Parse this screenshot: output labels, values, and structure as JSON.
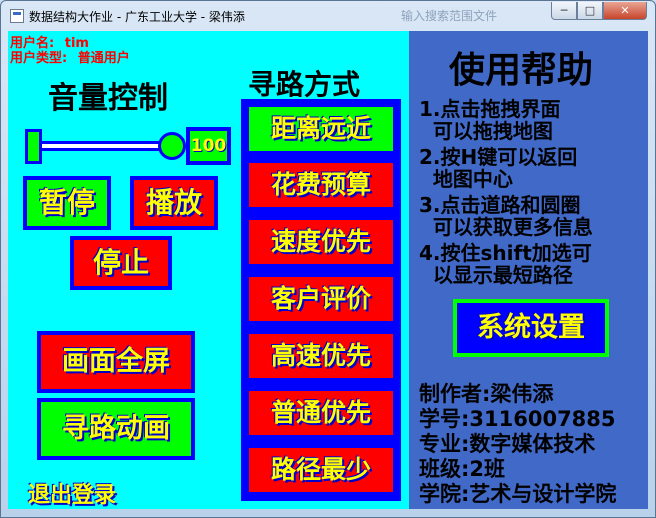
{
  "window": {
    "title": "数据结构大作业 - 广东工业大学 - 梁伟添",
    "ghost_text": "输入搜索范围文件",
    "minimize_glyph": "─",
    "maximize_glyph": "□",
    "close_glyph": "✕"
  },
  "user": {
    "name_label": "用户名:",
    "name_value": "tim",
    "type_label": "用户类型:",
    "type_value": "普通用户"
  },
  "volume": {
    "heading": "音量控制",
    "level": 100,
    "level_text": "100"
  },
  "playback": {
    "pause": "暂停",
    "play": "播放",
    "stop": "停止"
  },
  "buttons": {
    "fullscreen": "画面全屏",
    "route_anim": "寻路动画",
    "logout": "退出登录"
  },
  "route": {
    "heading": "寻路方式",
    "selected": "距离远近",
    "options": [
      "距离远近",
      "花费预算",
      "速度优先",
      "客户评价",
      "高速优先",
      "普通优先",
      "路径最少"
    ]
  },
  "help": {
    "heading": "使用帮助",
    "lines": [
      "1.点击拖拽界面",
      "  可以拖拽地图",
      "2.按H键可以返回",
      "  地图中心",
      "3.点击道路和圆圈",
      "  可以获取更多信息",
      "4.按住shift加选可",
      "  以显示最短路径"
    ],
    "settings_button": "系统设置"
  },
  "author": {
    "lines": [
      "制作者:梁伟添",
      "学号:3116007885",
      "专业:数字媒体技术",
      "班级:2班",
      "学院:艺术与设计学院"
    ]
  },
  "colors": {
    "left_bg": "#00ffff",
    "right_bg": "#4169c8",
    "accent_red": "#ff0000",
    "accent_green": "#00ff00",
    "accent_blue": "#0000ff",
    "text_yellow": "#ffff00"
  },
  "icons": {
    "app": "app-icon"
  }
}
